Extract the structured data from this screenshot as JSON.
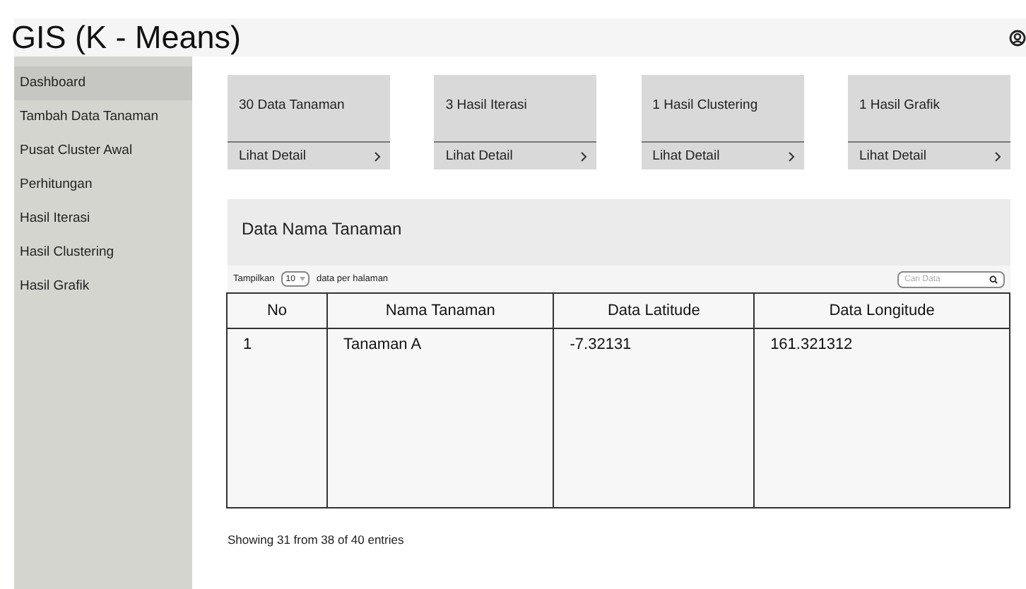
{
  "header": {
    "title": "GIS (K - Means)"
  },
  "sidebar": {
    "items": [
      {
        "label": "Dashboard",
        "selected": true
      },
      {
        "label": "Tambah Data Tanaman",
        "selected": false
      },
      {
        "label": "Pusat Cluster Awal",
        "selected": false
      },
      {
        "label": "Perhitungan",
        "selected": false
      },
      {
        "label": "Hasil Iterasi",
        "selected": false
      },
      {
        "label": "Hasil Clustering",
        "selected": false
      },
      {
        "label": "Hasil Grafik",
        "selected": false
      }
    ]
  },
  "cards": [
    {
      "title": "30 Data Tanaman",
      "link": "Lihat Detail"
    },
    {
      "title": "3 Hasil Iterasi",
      "link": "Lihat Detail"
    },
    {
      "title": "1 Hasil Clustering",
      "link": "Lihat Detail"
    },
    {
      "title": "1 Hasil Grafik",
      "link": "Lihat Detail"
    }
  ],
  "panel": {
    "title": "Data Nama Tanaman",
    "show_label": "Tampilkan",
    "page_size": "10",
    "per_page_label": "data per halaman",
    "search": {
      "placeholder": "Cari Data"
    },
    "table": {
      "columns": [
        "No",
        "Nama Tanaman",
        "Data Latitude",
        "Data Longitude"
      ],
      "rows": [
        [
          "1",
          "Tanaman A",
          "-7.32131",
          "161.321312"
        ]
      ]
    },
    "footer": "Showing 31 from 38 of 40 entries"
  }
}
